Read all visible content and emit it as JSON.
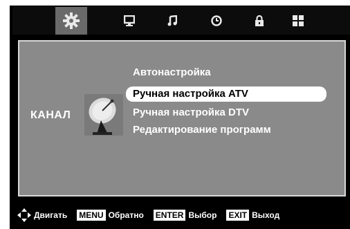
{
  "tabs": [
    {
      "icon": "gear-icon",
      "active": true
    },
    {
      "icon": "monitor-icon",
      "active": false
    },
    {
      "icon": "music-note-icon",
      "active": false
    },
    {
      "icon": "clock-icon",
      "active": false
    },
    {
      "icon": "lock-icon",
      "active": false
    },
    {
      "icon": "grid-icon",
      "active": false
    }
  ],
  "panel": {
    "category": "КАНАЛ",
    "items": [
      {
        "label": "Автонастройка",
        "selected": false
      },
      {
        "label": "Ручная настройка ATV",
        "selected": true
      },
      {
        "label": "Ручная настройка DTV",
        "selected": false
      },
      {
        "label": "Редактирование программ",
        "selected": false
      }
    ]
  },
  "footer": {
    "move": "Двигать",
    "menu_key": "MENU",
    "menu_text": "Обратно",
    "enter_key": "ENTER",
    "enter_text": "Выбор",
    "exit_key": "EXIT",
    "exit_text": "Выход"
  },
  "colors": {
    "panel_bg": "#8a8a8a",
    "bar_bg": "#000000",
    "active_tab": "#6a6a6a",
    "highlight": "#ffffff"
  }
}
